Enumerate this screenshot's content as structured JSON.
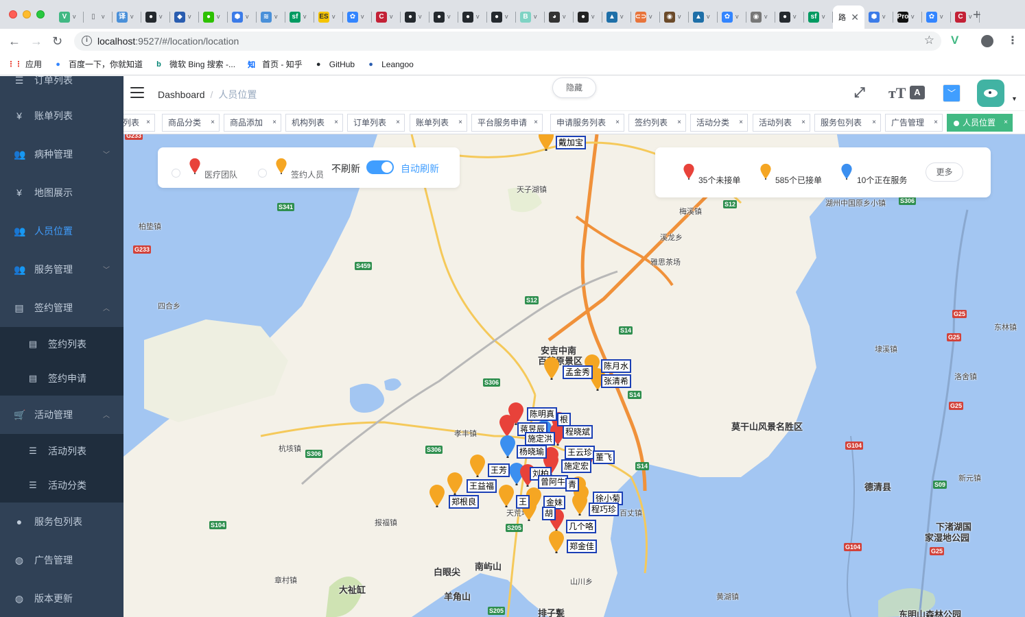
{
  "browser": {
    "tabs": [
      {
        "icon": "vue-icon",
        "color": "#41b883",
        "glyph": "V"
      },
      {
        "icon": "doc-icon",
        "color": "#ffffff",
        "glyph": "▯"
      },
      {
        "icon": "translate-icon",
        "color": "#4a90d9",
        "glyph": "译"
      },
      {
        "icon": "github-icon",
        "color": "#24292e",
        "glyph": "●"
      },
      {
        "icon": "leangoo-icon",
        "color": "#2a5db0",
        "glyph": "◆"
      },
      {
        "icon": "wechat-icon",
        "color": "#2dc100",
        "glyph": "●"
      },
      {
        "icon": "shield-icon",
        "color": "#3b7be8",
        "glyph": "⬢"
      },
      {
        "icon": "stack-icon",
        "color": "#4a90d9",
        "glyph": "≋"
      },
      {
        "icon": "sf-icon",
        "color": "#009a61",
        "glyph": "sf"
      },
      {
        "icon": "es-icon",
        "color": "#f5c400",
        "glyph": "ES"
      },
      {
        "icon": "baidu-icon",
        "color": "#3385ff",
        "glyph": "✿"
      },
      {
        "icon": "csdn-icon",
        "color": "#c32136",
        "glyph": "C"
      },
      {
        "icon": "github-icon",
        "color": "#24292e",
        "glyph": "●"
      },
      {
        "icon": "github-icon",
        "color": "#24292e",
        "glyph": "●"
      },
      {
        "icon": "github-icon",
        "color": "#24292e",
        "glyph": "●"
      },
      {
        "icon": "github-icon",
        "color": "#24292e",
        "glyph": "●"
      },
      {
        "icon": "bootstrap-icon",
        "color": "#7fd3c4",
        "glyph": "B"
      },
      {
        "icon": "panda-icon",
        "color": "#333333",
        "glyph": "◕"
      },
      {
        "icon": "user-icon",
        "color": "#222222",
        "glyph": "●"
      },
      {
        "icon": "cap-icon",
        "color": "#1e6fa8",
        "glyph": "▲"
      },
      {
        "icon": "link-icon",
        "color": "#e8743b",
        "glyph": "⊂⊃"
      },
      {
        "icon": "avatar-icon",
        "color": "#6b4a2a",
        "glyph": "◉"
      },
      {
        "icon": "cap-icon",
        "color": "#1e6fa8",
        "glyph": "▲"
      },
      {
        "icon": "baidu-icon",
        "color": "#3385ff",
        "glyph": "✿"
      },
      {
        "icon": "avatar-icon",
        "color": "#777777",
        "glyph": "◉"
      },
      {
        "icon": "github-icon",
        "color": "#24292e",
        "glyph": "●"
      },
      {
        "icon": "sf-icon",
        "color": "#009a61",
        "glyph": "sf"
      }
    ],
    "active_tab": {
      "title": "路",
      "close": "✕"
    },
    "tabs_after": [
      {
        "icon": "shield-icon",
        "color": "#3b7be8",
        "glyph": "⬢"
      },
      {
        "icon": "pro-icon",
        "color": "#111111",
        "glyph": "Pro"
      },
      {
        "icon": "baidu-icon",
        "color": "#3385ff",
        "glyph": "✿"
      },
      {
        "icon": "csdn-icon",
        "color": "#c32136",
        "glyph": "C"
      }
    ],
    "new_tab": "+",
    "url_host": "localhost",
    "url_rest": ":9527/#/location/location",
    "bookmarks": [
      {
        "icon": "apps-icon",
        "label": "应用",
        "color": "#e94235"
      },
      {
        "icon": "baidu-icon",
        "label": "百度一下，你就知道",
        "color": "#3385ff"
      },
      {
        "icon": "bing-icon",
        "label": "微软 Bing 搜索 -...",
        "color": "#008373"
      },
      {
        "icon": "zhihu-icon",
        "label": "首页 - 知乎",
        "color": "#0066ff"
      },
      {
        "icon": "github-icon",
        "label": "GitHub",
        "color": "#24292e"
      },
      {
        "icon": "leangoo-icon",
        "label": "Leangoo",
        "color": "#2a5db0"
      }
    ]
  },
  "sidebar": {
    "items": [
      {
        "label": "订单列表",
        "icon": "list-icon",
        "glyph": "☰"
      },
      {
        "label": "账单列表",
        "icon": "yen-icon",
        "glyph": "¥"
      },
      {
        "label": "病种管理",
        "icon": "users-icon",
        "glyph": "👥",
        "arrow": "﹀"
      },
      {
        "label": "地图展示",
        "icon": "yen-icon",
        "glyph": "¥"
      },
      {
        "label": "人员位置",
        "icon": "users-icon",
        "glyph": "👥"
      },
      {
        "label": "服务管理",
        "icon": "users-icon",
        "glyph": "👥",
        "arrow": "﹀"
      },
      {
        "label": "签约管理",
        "icon": "form-icon",
        "glyph": "▤",
        "arrow": "︿"
      },
      {
        "label": "活动管理",
        "icon": "cart-icon",
        "glyph": "🛒",
        "arrow": "︿"
      },
      {
        "label": "服务包列表",
        "icon": "user-icon",
        "glyph": "●"
      },
      {
        "label": "广告管理",
        "icon": "globe-icon",
        "glyph": "◍"
      },
      {
        "label": "版本更新",
        "icon": "globe-icon",
        "glyph": "◍"
      }
    ],
    "sign_sub": [
      {
        "label": "签约列表",
        "icon": "form-icon",
        "glyph": "▤"
      },
      {
        "label": "签约申请",
        "icon": "form-icon",
        "glyph": "▤"
      }
    ],
    "activity_sub": [
      {
        "label": "活动列表",
        "icon": "list-icon",
        "glyph": "☰"
      },
      {
        "label": "活动分类",
        "icon": "list-icon",
        "glyph": "☰"
      }
    ]
  },
  "navbar": {
    "breadcrumb": [
      "Dashboard",
      "人员位置"
    ],
    "hide_button": "隐藏",
    "lang_glyph": "A",
    "size_glyph": "тT",
    "fullscreen_glyph": "⤢"
  },
  "tags": [
    {
      "label": "列表"
    },
    {
      "label": "商品分类"
    },
    {
      "label": "商品添加"
    },
    {
      "label": "机构列表"
    },
    {
      "label": "订单列表"
    },
    {
      "label": "账单列表"
    },
    {
      "label": "平台服务申请"
    },
    {
      "label": "申请服务列表"
    },
    {
      "label": "签约列表"
    },
    {
      "label": "活动分类"
    },
    {
      "label": "活动列表"
    },
    {
      "label": "服务包列表"
    },
    {
      "label": "广告管理"
    },
    {
      "label": "人员位置",
      "active": true
    }
  ],
  "legend": {
    "medical_team": "医疗团队",
    "signing_staff": "签约人员",
    "no_refresh": "不刷新",
    "auto_refresh": "自动刷新",
    "auto_refresh_on": true
  },
  "stats": {
    "unaccepted": "35个未接单",
    "accepted": "585个已接单",
    "serving": "10个正在服务",
    "more": "更多"
  },
  "colors": {
    "red_pin": "#e8423a",
    "orange_pin": "#f5a623",
    "blue_pin": "#3b8ff0",
    "accent": "#409eff",
    "tag_active": "#42b983",
    "sidebar_bg": "#304156"
  },
  "map": {
    "places": [
      {
        "name": "天子湖镇"
      },
      {
        "name": "梅溪镇"
      },
      {
        "name": "溪龙乡"
      },
      {
        "name": "雅思茶场"
      },
      {
        "name": "柏垫镇"
      },
      {
        "name": "四合乡"
      },
      {
        "name": "安吉中南"
      },
      {
        "name": "百草原景区"
      },
      {
        "name": "孝丰镇"
      },
      {
        "name": "杭垓镇"
      },
      {
        "name": "报福镇"
      },
      {
        "name": "章村镇"
      },
      {
        "name": "大祉缸"
      },
      {
        "name": "白眼尖"
      },
      {
        "name": "南屿山"
      },
      {
        "name": "羊角山"
      },
      {
        "name": "排子甏"
      },
      {
        "name": "山川乡"
      },
      {
        "name": "莫干山风景名胜区"
      },
      {
        "name": "德清县"
      },
      {
        "name": "下渚湖国"
      },
      {
        "name": "家湿地公园"
      },
      {
        "name": "洛舍镇"
      },
      {
        "name": "东林镇"
      },
      {
        "name": "埭溪镇"
      },
      {
        "name": "新元镇"
      },
      {
        "name": "湖州中国原乡小镇"
      },
      {
        "name": "黄湖镇"
      },
      {
        "name": "东明山森林公园"
      },
      {
        "name": "百丈镇"
      },
      {
        "name": "天荒坪"
      }
    ],
    "roads": [
      {
        "id": "G233"
      },
      {
        "id": "S341"
      },
      {
        "id": "G233"
      },
      {
        "id": "S459"
      },
      {
        "id": "S12"
      },
      {
        "id": "S14"
      },
      {
        "id": "S306"
      },
      {
        "id": "S306"
      },
      {
        "id": "S306"
      },
      {
        "id": "S14"
      },
      {
        "id": "S14"
      },
      {
        "id": "S104"
      },
      {
        "id": "S205"
      },
      {
        "id": "S205"
      },
      {
        "id": "S12"
      },
      {
        "id": "G25"
      },
      {
        "id": "G25"
      },
      {
        "id": "G25"
      },
      {
        "id": "G104"
      },
      {
        "id": "G104"
      },
      {
        "id": "S09"
      },
      {
        "id": "G25"
      },
      {
        "id": "S306"
      }
    ],
    "people": [
      {
        "name": "戴加宝",
        "pin": "orange"
      },
      {
        "name": "孟金秀",
        "pin": "orange"
      },
      {
        "name": "陈月水",
        "pin": "orange"
      },
      {
        "name": "张清希",
        "pin": "orange"
      },
      {
        "name": "陈明真",
        "pin": "red"
      },
      {
        "name": "根",
        "pin": "red"
      },
      {
        "name": "蒋昱辰",
        "pin": "red"
      },
      {
        "name": "施定洪",
        "pin": "blue"
      },
      {
        "name": "程晓斌",
        "pin": "red"
      },
      {
        "name": "杨晓瑜",
        "pin": "blue"
      },
      {
        "name": "王云珍",
        "pin": "red"
      },
      {
        "name": "董飞",
        "pin": "red"
      },
      {
        "name": "施定宏",
        "pin": "red"
      },
      {
        "name": "王芳",
        "pin": "orange"
      },
      {
        "name": "刘柏",
        "pin": "blue"
      },
      {
        "name": "曾阿牛",
        "pin": "red"
      },
      {
        "name": "王益福",
        "pin": "orange"
      },
      {
        "name": "郑根良",
        "pin": "orange"
      },
      {
        "name": "青",
        "pin": "orange"
      },
      {
        "name": "王",
        "pin": "orange"
      },
      {
        "name": "金妹",
        "pin": "orange"
      },
      {
        "name": "胡",
        "pin": "orange"
      },
      {
        "name": "徐小菊",
        "pin": "orange"
      },
      {
        "name": "程巧珍",
        "pin": "orange"
      },
      {
        "name": "几个咯",
        "pin": "red"
      },
      {
        "name": "郑金佳",
        "pin": "orange"
      }
    ]
  }
}
